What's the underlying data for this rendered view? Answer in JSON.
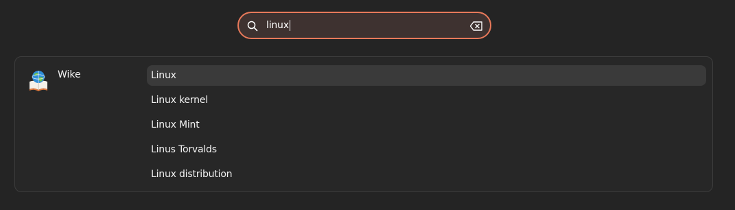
{
  "search": {
    "value": "linux",
    "icon": "search-icon",
    "clear_icon": "backspace-clear-icon"
  },
  "provider": {
    "name": "Wike",
    "icon": "wike-globe-book-icon"
  },
  "results": [
    {
      "label": "Linux",
      "selected": true
    },
    {
      "label": "Linux kernel",
      "selected": false
    },
    {
      "label": "Linux Mint",
      "selected": false
    },
    {
      "label": "Linus Torvalds",
      "selected": false
    },
    {
      "label": "Linux distribution",
      "selected": false
    }
  ],
  "colors": {
    "background": "#242424",
    "search_border": "#e8795a",
    "search_fill": "#3e3230",
    "panel": "#272727",
    "selected_row": "#3a3a3a"
  }
}
